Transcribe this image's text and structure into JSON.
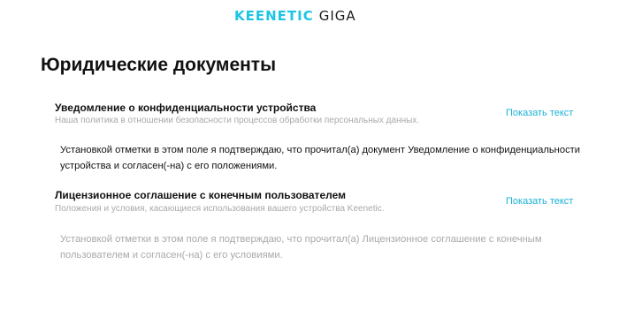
{
  "header": {
    "brand": "KEENETIC",
    "model": "GIGA"
  },
  "page": {
    "title": "Юридические документы"
  },
  "documents": [
    {
      "title": "Уведомление о конфиденциальности устройства",
      "description": "Наша политика в отношении безопасности процессов обработки персональных данных.",
      "show_link": "Показать текст",
      "consent": "Установкой отметки в этом поле я подтверждаю, что прочитал(а) документ Уведомление о конфиденциальности устройства и согласен(-на) с его положениями."
    },
    {
      "title": "Лицензионное соглашение с конечным пользователем",
      "description": "Положения и условия, касающиеся использования вашего устройства Keenetic.",
      "show_link": "Показать текст",
      "consent": "Установкой отметки в этом поле я подтверждаю, что прочитал(а) Лицензионное соглашение с конечным пользователем и согласен(-на) с его условиями."
    }
  ]
}
